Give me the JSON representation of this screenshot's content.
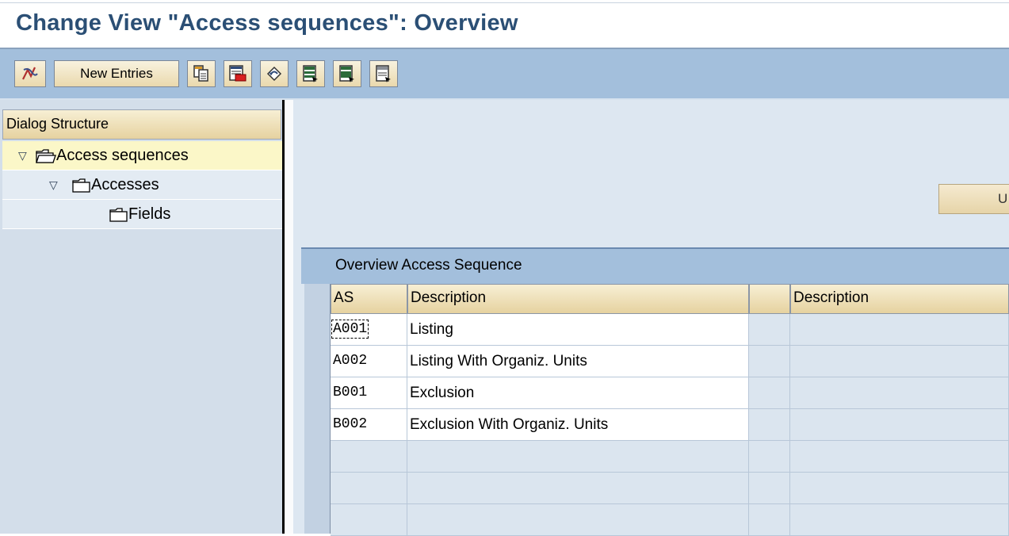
{
  "title": "Change View \"Access sequences\": Overview",
  "toolbar": {
    "new_entries_label": "New Entries",
    "icons": [
      "display-change-icon",
      "copy-icon",
      "delete-icon",
      "undo-icon",
      "select-all-icon",
      "select-block-icon",
      "deselect-all-icon"
    ]
  },
  "dialog_structure": {
    "header": "Dialog Structure",
    "items": [
      {
        "label": "Access sequences",
        "level": 0,
        "expanded": true,
        "selected": true
      },
      {
        "label": "Accesses",
        "level": 1,
        "expanded": true,
        "selected": false
      },
      {
        "label": "Fields",
        "level": 2,
        "expanded": false,
        "selected": false
      }
    ]
  },
  "side_button_label": "U",
  "table": {
    "title": "Overview Access Sequence",
    "columns": [
      "AS",
      "Description",
      "",
      "Description"
    ],
    "rows": [
      {
        "as": "A001",
        "description": "Listing"
      },
      {
        "as": "A002",
        "description": "Listing With Organiz. Units"
      },
      {
        "as": "B001",
        "description": "Exclusion"
      },
      {
        "as": "B002",
        "description": "Exclusion With Organiz. Units"
      },
      {
        "as": "",
        "description": ""
      },
      {
        "as": "",
        "description": ""
      },
      {
        "as": "",
        "description": ""
      }
    ]
  },
  "colors": {
    "title_text": "#2b4f75",
    "toolbar_bg": "#a3bfdc",
    "button_bg": "#ead9ad",
    "selected_tree_row": "#fbf7c8",
    "panel_bg": "#d3deea"
  }
}
